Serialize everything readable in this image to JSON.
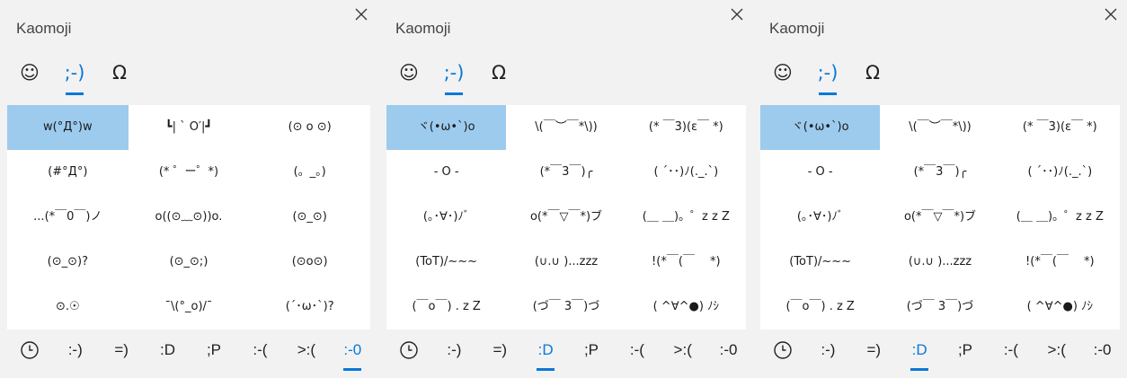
{
  "panels": [
    {
      "title": "Kaomoji",
      "tabs": [
        {
          "label": "☺",
          "icon": "smiley-icon"
        },
        {
          "label": ";-)",
          "icon": "kaomoji-icon"
        },
        {
          "label": "Ω",
          "icon": "symbols-icon"
        }
      ],
      "active_tab": 1,
      "selected_cell": 0,
      "cells": [
        "w(°Д°)w",
        "┗| ` O′|┛",
        "(⊙ o ⊙)",
        "(#°Д°)",
        "(* ゜ー゜*)",
        "(。_。)",
        "...(*￣0￣)ノ",
        "o((⊙﹏⊙))o.",
        "(⊙_⊙)",
        "(⊙_⊙)?",
        "(⊙_⊙;)",
        "(⊙o⊙)",
        "⊙.☉",
        "¯\\(°_o)/¯",
        "(´･ω･`)?"
      ],
      "bottom_tabs": [
        ":-)",
        "=)",
        ":D",
        ";P",
        ":-(",
        ">:(",
        ":-0"
      ],
      "active_bottom": 6
    },
    {
      "title": "Kaomoji",
      "tabs": [
        {
          "label": "☺",
          "icon": "smiley-icon"
        },
        {
          "label": ";-)",
          "icon": "kaomoji-icon"
        },
        {
          "label": "Ω",
          "icon": "symbols-icon"
        }
      ],
      "active_tab": 1,
      "selected_cell": 0,
      "cells": [
        "ヾ(•ω•`)o",
        "\\(￣︶￣*\\))",
        "(* ￣3)(ε￣ *)",
        "- O -",
        "(*￣3￣)╭",
        "( ´･･)ﾉ(._.`)",
        "(｡･∀･)ﾉﾞ",
        "o(*￣▽￣*)ブ",
        "(＿ ＿)。゜z z Z",
        "(ToT)/~~~",
        "(∪.∪ )...zzz",
        "!(*￣(￣ 　*)",
        "(￣o￣) . z Z",
        "(づ￣ 3￣)づ",
        "( ^∀^●) ﾉｼ"
      ],
      "bottom_tabs": [
        ":-)",
        "=)",
        ":D",
        ";P",
        ":-(",
        ">:(",
        ":-0"
      ],
      "active_bottom": 2
    },
    {
      "title": "Kaomoji",
      "tabs": [
        {
          "label": "☺",
          "icon": "smiley-icon"
        },
        {
          "label": ";-)",
          "icon": "kaomoji-icon"
        },
        {
          "label": "Ω",
          "icon": "symbols-icon"
        }
      ],
      "active_tab": 1,
      "selected_cell": 0,
      "cells": [
        "ヾ(•ω•`)o",
        "\\(￣︶￣*\\))",
        "(* ￣3)(ε￣ *)",
        "- O -",
        "(*￣3￣)╭",
        "( ´･･)ﾉ(._.`)",
        "(｡･∀･)ﾉﾞ",
        "o(*￣▽￣*)ブ",
        "(＿ ＿)。゜z z Z",
        "(ToT)/~~~",
        "(∪.∪ )...zzz",
        "!(*￣(￣ 　*)",
        "(￣o￣) . z Z",
        "(づ￣ 3￣)づ",
        "( ^∀^●) ﾉｼ"
      ],
      "bottom_tabs": [
        ":-)",
        "=)",
        ":D",
        ";P",
        ":-(",
        ">:(",
        ":-0"
      ],
      "active_bottom": 2
    }
  ],
  "colors": {
    "accent": "#0a78d7",
    "selection": "#9ccbee",
    "panel_bg": "#f2f2f2",
    "grid_bg": "#ffffff"
  }
}
